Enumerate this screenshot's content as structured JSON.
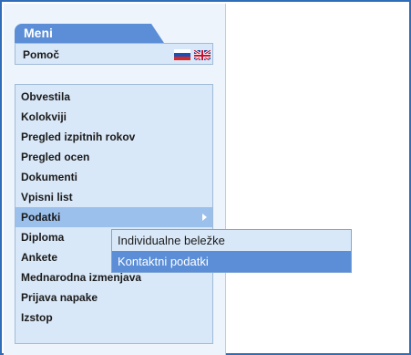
{
  "menu": {
    "title": "Meni",
    "help_label": "Pomoč",
    "languages": [
      "sl",
      "en"
    ],
    "items": [
      {
        "label": "Obvestila"
      },
      {
        "label": "Kolokviji"
      },
      {
        "label": "Pregled izpitnih rokov"
      },
      {
        "label": "Pregled ocen"
      },
      {
        "label": "Dokumenti"
      },
      {
        "label": "Vpisni list"
      },
      {
        "label": "Podatki",
        "active": true
      },
      {
        "label": "Diploma"
      },
      {
        "label": "Ankete"
      },
      {
        "label": "Mednarodna izmenjava"
      },
      {
        "label": "Prijava napake"
      },
      {
        "label": "Izstop"
      }
    ]
  },
  "submenu": {
    "items": [
      {
        "label": "Individualne beležke"
      },
      {
        "label": "Kontaktni podatki",
        "highlighted": true
      }
    ]
  },
  "colors": {
    "accent": "#5b8ed6",
    "panel": "#d9e8f8",
    "active": "#9cc0ec",
    "frame_border": "#2f6db8"
  }
}
